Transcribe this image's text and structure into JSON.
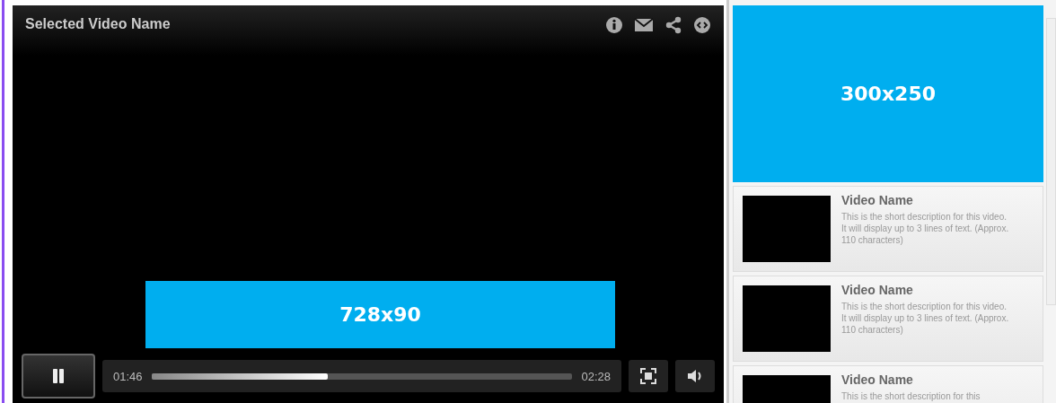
{
  "player": {
    "title": "Selected Video Name",
    "overlay_ad": {
      "label": "728x90"
    },
    "playing": true,
    "elapsed": "01:46",
    "progress": {
      "level": 0.42
    },
    "duration": "02:28"
  },
  "sidebar": {
    "ad": {
      "label": "300x250"
    },
    "videos": [
      {
        "name": "Video Name",
        "description": "This is the short description for this video. It will display up to 3 lines of text. (Approx. 110 characters)"
      },
      {
        "name": "Video Name",
        "description": "This is the short description for this video. It will display up to 3 lines of text. (Approx. 110 characters)"
      },
      {
        "name": "Video Name",
        "description": "This is the short description for this"
      }
    ]
  }
}
